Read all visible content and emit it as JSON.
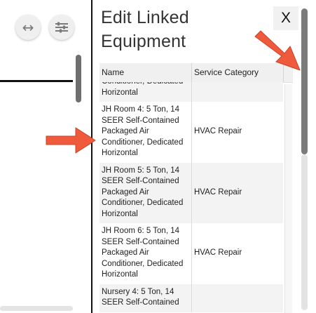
{
  "left_panel": {
    "expand_icon": "left-right-arrow-icon",
    "filter_icon": "sliders-icon"
  },
  "modal": {
    "title": "Edit Linked Equipment",
    "close_label": "X",
    "table": {
      "headers": [
        "Name",
        "Service Category"
      ],
      "rows": [
        {
          "name": "Conditioner, Dedicated Horizontal",
          "category": ""
        },
        {
          "name": "JH Room 4: 5 Ton, 14 SEER Self-Contained Packaged Air Conditioner, Dedicated Horizontal",
          "category": "HVAC Repair"
        },
        {
          "name": "JH Room 5: 5 Ton, 14 SEER Self-Contained Packaged Air Conditioner, Dedicated Horizontal",
          "category": "HVAC Repair"
        },
        {
          "name": "JH Room 6: 5 Ton, 14 SEER Self-Contained Packaged Air Conditioner, Dedicated Horizontal",
          "category": "HVAC Repair"
        },
        {
          "name": "Nursery 4: 5 Ton, 14 SEER Self-Contained",
          "category": ""
        }
      ]
    }
  },
  "annotations": {
    "arrow_color": "#f05a3c"
  }
}
